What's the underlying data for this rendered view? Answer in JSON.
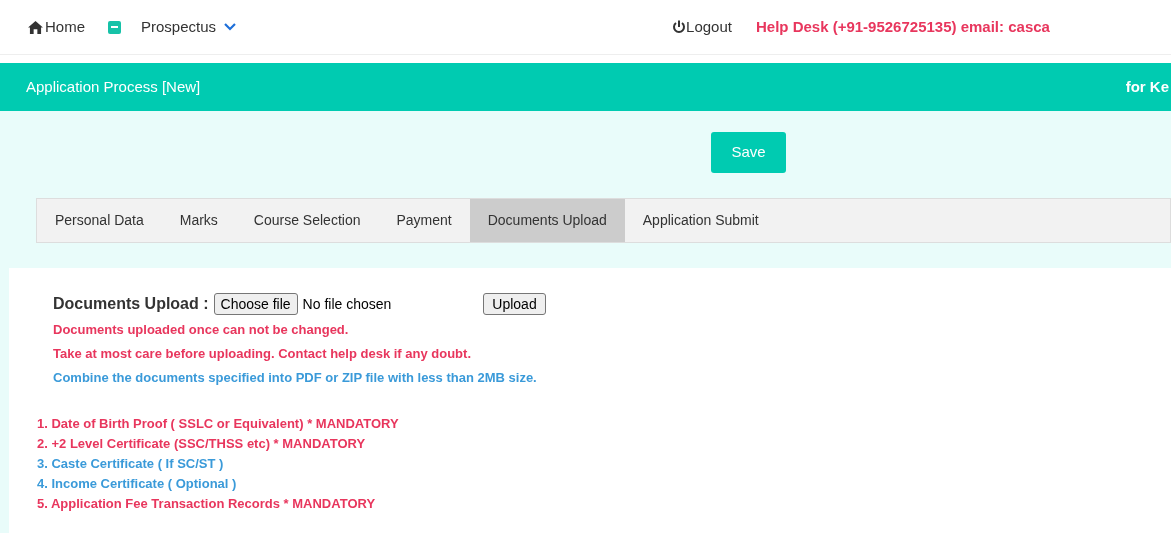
{
  "nav": {
    "home": "Home",
    "prospectus": "Prospectus",
    "logout": "Logout",
    "helpdesk": "Help Desk (+91-9526725135) email: casca"
  },
  "header": {
    "title": "Application Process [New]",
    "right_text": "for Ke"
  },
  "save_button": "Save",
  "tabs": [
    {
      "label": "Personal Data",
      "selected": false
    },
    {
      "label": "Marks",
      "selected": false
    },
    {
      "label": "Course Selection",
      "selected": false
    },
    {
      "label": "Payment",
      "selected": false
    },
    {
      "label": "Documents Upload",
      "selected": true
    },
    {
      "label": "Application Submit",
      "selected": false
    }
  ],
  "upload": {
    "label": "Documents Upload :",
    "choose_button": "Choose file",
    "file_status": "No file chosen",
    "upload_button": "Upload"
  },
  "notes": [
    {
      "text": "Documents uploaded once can not be changed.",
      "color": "#e8365d"
    },
    {
      "text": "Take at most care before uploading. Contact help desk if any doubt.",
      "color": "#e8365d"
    },
    {
      "text": "Combine the documents specified into PDF or ZIP file with less than 2MB size.",
      "color": "#3a9ad9"
    }
  ],
  "documents": [
    {
      "text": "1. Date of Birth Proof ( SSLC or Equivalent) * MANDATORY",
      "color": "#e8365d"
    },
    {
      "text": "2. +2 Level Certificate (SSC/THSS etc) * MANDATORY",
      "color": "#e8365d"
    },
    {
      "text": "3. Caste Certificate ( If SC/ST )",
      "color": "#3a9ad9"
    },
    {
      "text": "4. Income Certificate ( Optional )",
      "color": "#3a9ad9"
    },
    {
      "text": "5. Application Fee Transaction Records * MANDATORY",
      "color": "#e8365d"
    }
  ]
}
